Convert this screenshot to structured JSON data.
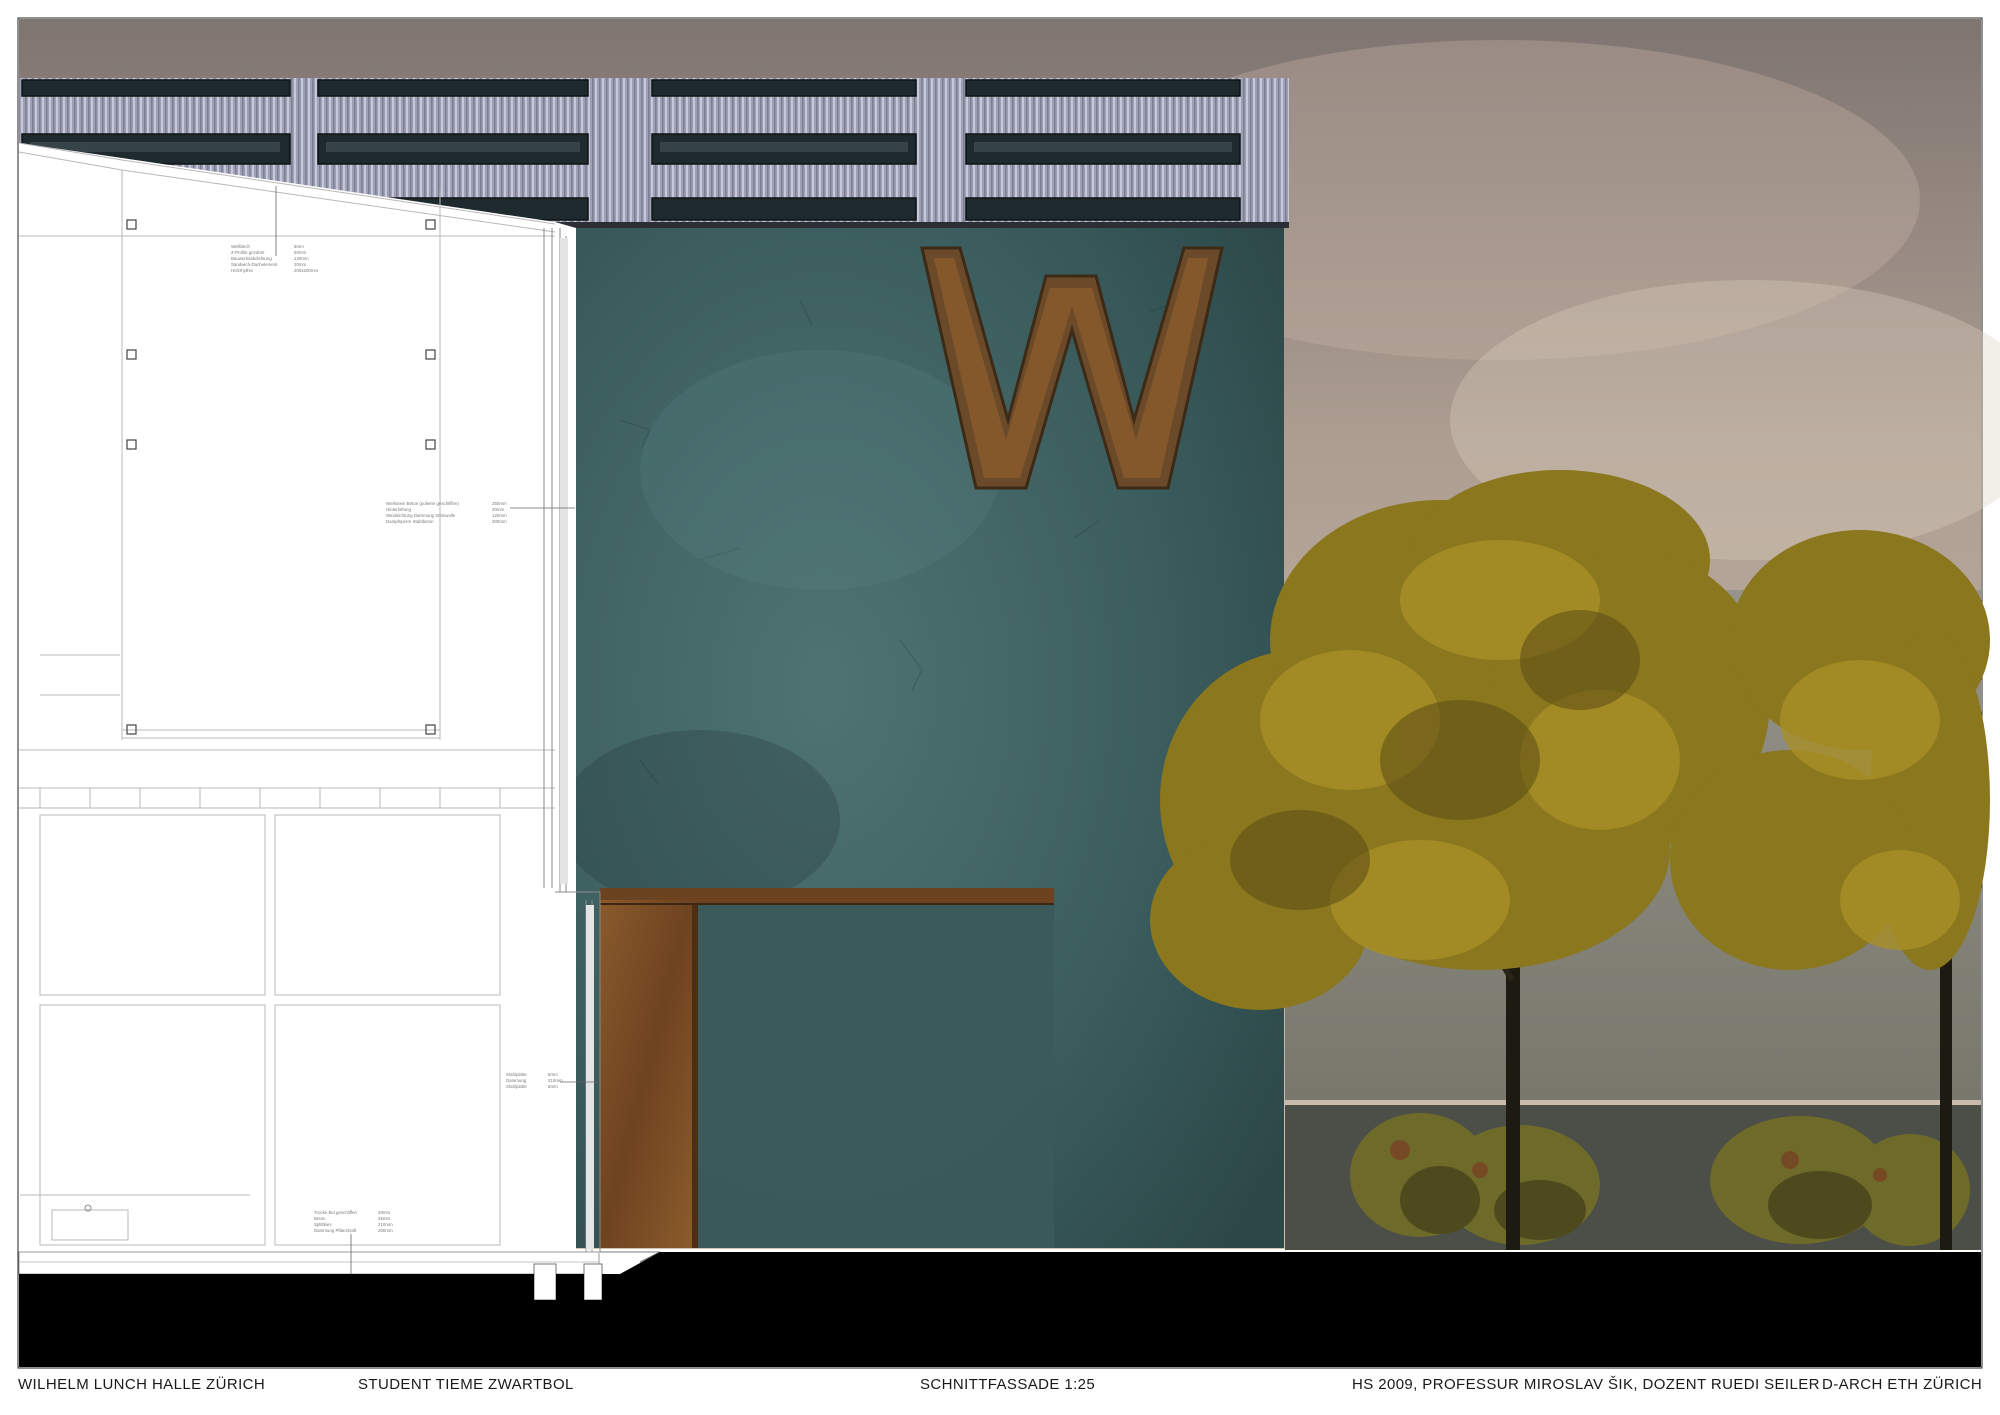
{
  "sign": {
    "letter": "W"
  },
  "annotations": {
    "roof": [
      "Wellblech",
      "Z-Profile gezahnt",
      "Bauwerksabdichtung",
      "Sandwich-Dachelement",
      "Holzrhythm"
    ],
    "roof_values": [
      "8mm",
      "60mm",
      "120mm",
      "20mm",
      "200x200mm"
    ],
    "wall": [
      "Werkstein Beton (polierte geschliffen)",
      "Hinterluftung",
      "Winddichtung Dammung Steinwolle",
      "Dampfsperre Stahlbeton"
    ],
    "wall_values": [
      "250mm",
      "20mm",
      "120mm",
      "300mm"
    ],
    "lower_wall": [
      "Stahlplatte",
      "Dammung",
      "Stahlplatte"
    ],
    "lower_wall_values": [
      "5mm",
      "210mm",
      "5mm"
    ],
    "floor": [
      "Trocke Bel geschliffen",
      "Beton",
      "Splittkies",
      "Dammung Pflanzkraft"
    ],
    "floor_values": [
      "20mm",
      "35mm",
      "210mm",
      "200mm"
    ]
  },
  "footer": {
    "project": "WILHELM LUNCH HALLE ZÜRICH",
    "student": "STUDENT TIEME ZWARTBOL",
    "drawing": "SCHNITTFASSADE 1:25",
    "semester": "HS 2009, PROFESSUR MIROSLAV ŠIK, DOZENT RUEDI SEILER",
    "school": "D-ARCH ETH ZÜRICH"
  },
  "colors": {
    "sky_top": "#7f7571",
    "sky_bottom": "#c8b8a6",
    "concrete": "#3f6262",
    "rust": "#7a4a22",
    "foliage": "#8d7a1c",
    "ground": "#000000"
  }
}
